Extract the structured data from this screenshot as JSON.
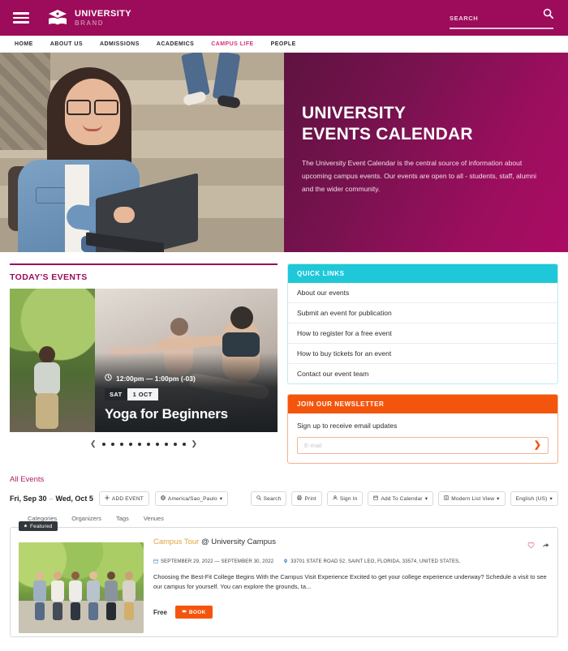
{
  "header": {
    "brand_line1": "UNIVERSITY",
    "brand_line2": "BRAND",
    "menu_icon": "hamburger-icon",
    "logo_icon": "graduation-book-icon",
    "search_placeholder": "SEARCH",
    "search_value": "",
    "search_icon": "magnifier-icon"
  },
  "nav": {
    "items": [
      {
        "label": "HOME",
        "active": false
      },
      {
        "label": "ABOUT US",
        "active": false
      },
      {
        "label": "ADMISSIONS",
        "active": false
      },
      {
        "label": "ACADEMICS",
        "active": false
      },
      {
        "label": "CAMPUS LIFE",
        "active": true
      },
      {
        "label": "PEOPLE",
        "active": false
      }
    ]
  },
  "hero": {
    "image_alt": "student-with-laptop-on-steps",
    "title": "UNIVERSITY\nEVENTS CALENDAR",
    "description": "The University Event Calendar is the central source of information about upcoming campus events. Our events are open to all - students, staff, alumni and the wider community."
  },
  "todays_events": {
    "section_title": "TODAY'S EVENTS",
    "slide": {
      "time": "12:00pm — 1:00pm (-03)",
      "clock_icon": "clock-icon",
      "day": "SAT",
      "date": "1 OCT",
      "title": "Yoga for Beginners",
      "image_alt": "yoga-class"
    },
    "prev_slide_image_alt": "students-walking",
    "carousel": {
      "prev_icon": "chevron-left-icon",
      "next_icon": "chevron-right-icon",
      "dots": 10,
      "active_dot": 0
    }
  },
  "quick_links": {
    "title": "QUICK LINKS",
    "items": [
      "About our events",
      "Submit an event for publication",
      "How to register for a free event",
      "How to buy tickets for an event",
      "Contact our event team"
    ]
  },
  "newsletter": {
    "title": "JOIN OUR NEWSLETTER",
    "text": "Sign up to receive email updates",
    "email_placeholder": "E-mail",
    "email_value": "",
    "submit_icon": "chevron-right-icon"
  },
  "events": {
    "all_events_label": "All Events",
    "date_from": "Fri, Sep 30",
    "date_to": "Wed, Oct 5",
    "date_separator": "–",
    "add_event_label": "ADD EVENT",
    "add_event_icon": "plus-icon",
    "timezone_label": "America/Sao_Paulo",
    "timezone_icon": "globe-icon",
    "timezone_caret": "▾",
    "toolbar_buttons": [
      {
        "label": "Search",
        "icon": "magnifier-icon",
        "caret": ""
      },
      {
        "label": "Print",
        "icon": "printer-icon",
        "caret": ""
      },
      {
        "label": "Sign In",
        "icon": "user-icon",
        "caret": ""
      },
      {
        "label": "Add To Calendar",
        "icon": "calendar-icon",
        "caret": "▾"
      },
      {
        "label": "Modern List View",
        "icon": "list-icon",
        "caret": "▾"
      },
      {
        "label": "English (US)",
        "icon": "",
        "caret": "▾"
      }
    ],
    "tabs": [
      "Categories",
      "Organizers",
      "Tags",
      "Venues"
    ],
    "card": {
      "featured_label": "Featured",
      "featured_icon": "star-icon",
      "title_highlight": "Campus Tour",
      "title_rest": " @ University Campus",
      "date_icon": "calendar-icon",
      "date_text": "SEPTEMBER 29, 2022 — SEPTEMBER 30, 2022",
      "location_icon": "map-pin-icon",
      "location_text": "33701 STATE ROAD 52, SAINT LEO, FLORIDA, 33574, UNITED STATES,",
      "description": "Choosing the Best-Fit College Begins With the Campus Visit Experience Excited to get your college experience underway? Schedule a visit to see our campus for yourself. You can explore the grounds, ta...",
      "price": "Free",
      "book_label": "BOOK",
      "book_icon": "ticket-icon",
      "favorite_icon": "heart-icon",
      "share_icon": "share-icon",
      "image_alt": "students-walking-on-campus-path"
    }
  },
  "colors": {
    "brand_maroon": "#9c0c5a",
    "brand_pink": "#d5317f",
    "cyan": "#1ec8d8",
    "orange": "#f4550d",
    "gold": "#e0a43b"
  }
}
